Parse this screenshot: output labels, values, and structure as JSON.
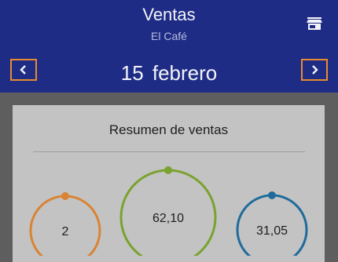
{
  "header": {
    "title": "Ventas",
    "subtitle": "El Café",
    "store_icon": "store-icon",
    "prev_icon": "chevron-left-icon",
    "next_icon": "chevron-right-icon",
    "date": "15  febrero"
  },
  "summary": {
    "title": "Resumen de ventas",
    "stats": [
      {
        "value": "2",
        "color": "#d98433"
      },
      {
        "value": "62,10",
        "color": "#7aa22e"
      },
      {
        "value": "31,05",
        "color": "#1f6b9c"
      }
    ]
  },
  "colors": {
    "header_bg": "#1f2c86",
    "nav_highlight": "#e88a2e",
    "overlay_bg": "#5e5e5e",
    "card_bg": "#c3c3c3"
  }
}
